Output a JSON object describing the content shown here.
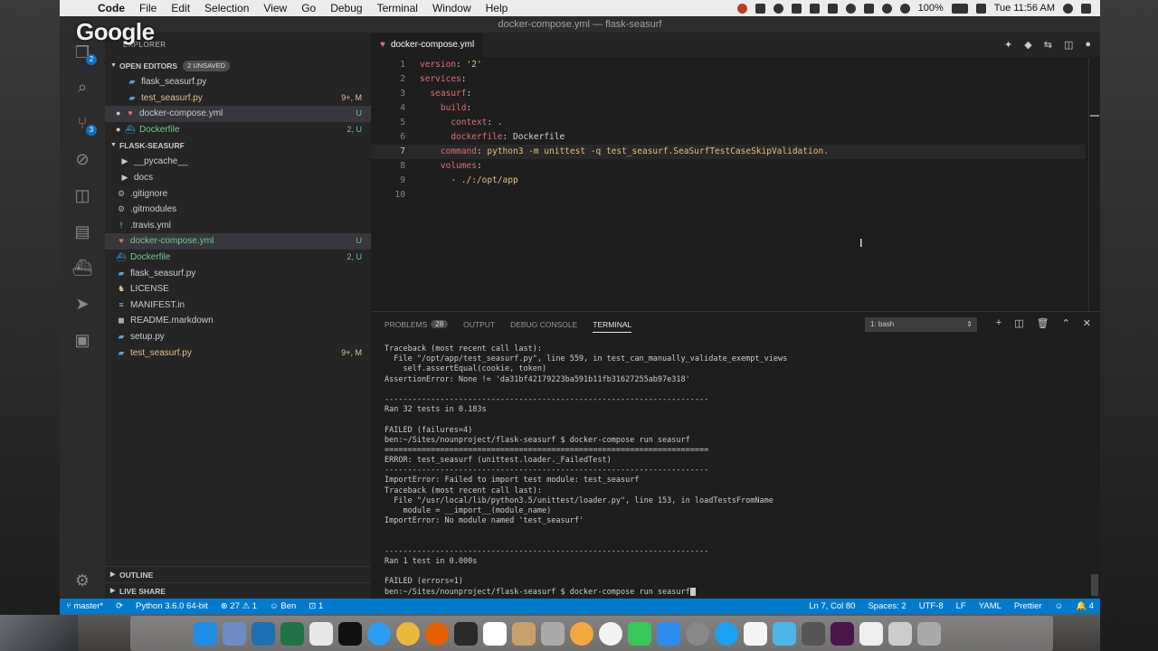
{
  "menubar": {
    "app_name": "Code",
    "items": [
      "File",
      "Edit",
      "Selection",
      "View",
      "Go",
      "Debug",
      "Terminal",
      "Window",
      "Help"
    ],
    "battery": "100%",
    "clock": "Tue 11:56 AM"
  },
  "watermark": "Google",
  "window_title": "docker-compose.yml — flask-seasurf",
  "sidebar": {
    "header": "EXPLORER",
    "open_editors": {
      "title": "OPEN EDITORS",
      "unsaved": "2 UNSAVED"
    },
    "open_files": [
      {
        "name": "flask_seasurf.py",
        "status": ""
      },
      {
        "name": "test_seasurf.py",
        "status": "9+, M"
      },
      {
        "name": "docker-compose.yml",
        "status": "U"
      },
      {
        "name": "Dockerfile",
        "status": "2, U"
      }
    ],
    "project": "FLASK-SEASURF",
    "files": [
      {
        "name": "__pycache__",
        "status": ""
      },
      {
        "name": "docs",
        "status": ""
      },
      {
        "name": ".gitignore",
        "status": ""
      },
      {
        "name": ".gitmodules",
        "status": ""
      },
      {
        "name": ".travis.yml",
        "status": ""
      },
      {
        "name": "docker-compose.yml",
        "status": "U"
      },
      {
        "name": "Dockerfile",
        "status": "2, U"
      },
      {
        "name": "flask_seasurf.py",
        "status": ""
      },
      {
        "name": "LICENSE",
        "status": ""
      },
      {
        "name": "MANIFEST.in",
        "status": ""
      },
      {
        "name": "README.markdown",
        "status": ""
      },
      {
        "name": "setup.py",
        "status": ""
      },
      {
        "name": "test_seasurf.py",
        "status": "9+, M"
      }
    ],
    "outline": "OUTLINE",
    "live_share": "LIVE SHARE"
  },
  "activity_badges": {
    "explorer": "2",
    "scm": "3"
  },
  "editor": {
    "tab": "docker-compose.yml",
    "line_numbers": [
      "1",
      "2",
      "3",
      "4",
      "5",
      "6",
      "7",
      "8",
      "9",
      "10"
    ],
    "line1_key": "version",
    "line1_val": "'2'",
    "line2_key": "services",
    "line3_key": "seasurf",
    "line4_key": "build",
    "line5_key": "context",
    "line5_val": ".",
    "line6_key": "dockerfile",
    "line6_val": "Dockerfile",
    "line7_key": "command",
    "line7_val": "python3 -m unittest -q test_seasurf.SeaSurfTestCaseSkipValidation.",
    "line8_key": "volumes",
    "line9_val": "- ./:/opt/app"
  },
  "panel": {
    "tabs": {
      "problems": "PROBLEMS",
      "problems_count": "28",
      "output": "OUTPUT",
      "debug": "DEBUG CONSOLE",
      "terminal": "TERMINAL"
    },
    "terminal_select": "1: bash",
    "lines": [
      "Traceback (most recent call last):",
      "  File \"/opt/app/test_seasurf.py\", line 559, in test_can_manually_validate_exempt_views",
      "    self.assertEqual(cookie, token)",
      "AssertionError: None != 'da31bf42179223ba591b11fb31627255ab97e318'",
      "",
      "----------------------------------------------------------------------",
      "Ran 32 tests in 0.183s",
      "",
      "FAILED (failures=4)",
      "ben:~/Sites/nounproject/flask-seasurf $ docker-compose run seasurf",
      "======================================================================",
      "ERROR: test_seasurf (unittest.loader._FailedTest)",
      "----------------------------------------------------------------------",
      "ImportError: Failed to import test module: test_seasurf",
      "Traceback (most recent call last):",
      "  File \"/usr/local/lib/python3.5/unittest/loader.py\", line 153, in loadTestsFromName",
      "    module = __import__(module_name)",
      "ImportError: No module named 'test_seasurf'",
      "",
      "",
      "----------------------------------------------------------------------",
      "Ran 1 test in 0.000s",
      "",
      "FAILED (errors=1)",
      "ben:~/Sites/nounproject/flask-seasurf $ docker-compose run seasurf"
    ]
  },
  "statusbar": {
    "branch": "master*",
    "python": "Python 3.6.0 64-bit",
    "errors": "27",
    "warnings": "1",
    "user": "Ben",
    "live": "1",
    "position": "Ln 7, Col 80",
    "spaces": "Spaces: 2",
    "encoding": "UTF-8",
    "eol": "LF",
    "language": "YAML",
    "formatter": "Prettier",
    "notifications": "4"
  },
  "colors": {
    "accent": "#007acc",
    "modified": "#e2c08d",
    "untracked": "#73c991",
    "yaml_key": "#e06c75",
    "yaml_string": "#e5c07b"
  }
}
